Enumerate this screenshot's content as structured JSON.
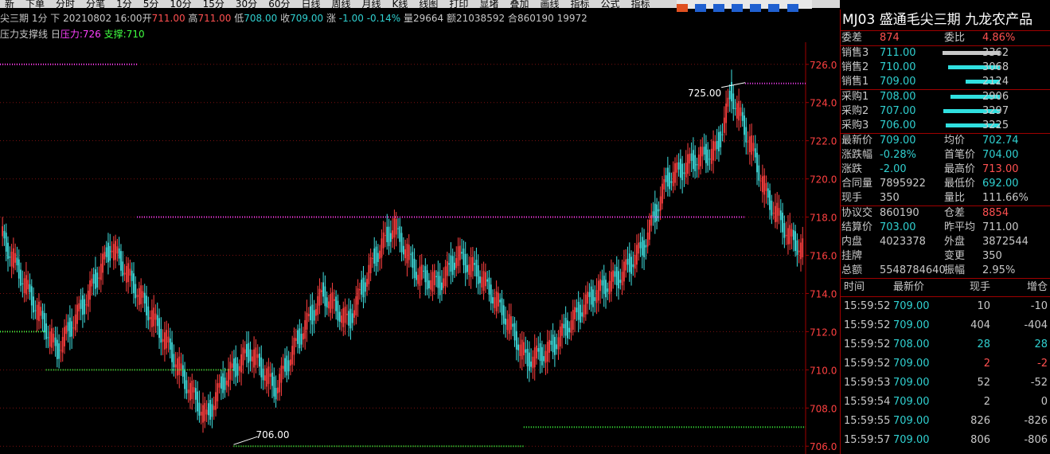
{
  "menubar": [
    "新",
    "下单",
    "分时",
    "分笔",
    "1分",
    "5分",
    "10分",
    "15分",
    "30分",
    "60分",
    "日线",
    "周线",
    "月线",
    "K线",
    "线图",
    "打印",
    "显堵",
    "叠加",
    "画线",
    "指标",
    "公式",
    "指标"
  ],
  "info": {
    "name": "尖三期 1分 下",
    "date": "20210802 16:00",
    "open_label": "开",
    "open": "711.00",
    "high_label": "高",
    "high": "711.00",
    "low_label": "低",
    "low": "708.00",
    "close_label": "收",
    "close": "709.00",
    "chg_label": "涨",
    "chg": "-1.00",
    "chg_pct": "-0.14%",
    "vol_label": "量",
    "vol": "29664",
    "amt_label": "额",
    "amt": "21038592",
    "oi_label": "合",
    "oi": "860190",
    "extra": "19972"
  },
  "legend": {
    "name": "压力支撑线",
    "collapse": "日",
    "resistance_label": "压力:",
    "resistance": "726",
    "support_label": "支撑:",
    "support": "710"
  },
  "chart_data": {
    "type": "candlestick",
    "ylim": [
      706,
      727
    ],
    "yticks": [
      "726.0",
      "724.0",
      "722.0",
      "720.0",
      "718.0",
      "716.0",
      "714.0",
      "712.0",
      "710.0",
      "708.0",
      "706.0"
    ],
    "annotations": [
      {
        "text": "725.00",
        "value": 725
      },
      {
        "text": "706.00",
        "value": 706
      }
    ],
    "resistance_lines": [
      726,
      718,
      725
    ],
    "support_lines": [
      712,
      710,
      706,
      707
    ],
    "colors": {
      "up": "#ff4040",
      "down": "#40e0e0",
      "resistance": "#ff40ff",
      "support": "#40ff40",
      "grid": "#7a1010",
      "axis": "#a00000"
    }
  },
  "panel": {
    "title": "MJ03  盛通毛尖三期   九龙农产品",
    "weicha_label": "委差",
    "weicha": "874",
    "weibi_label": "委比",
    "weibi": "4.86%",
    "asks": [
      {
        "label": "销售3",
        "price": "711.00",
        "vol": "3362",
        "bar": 1.0,
        "grey": true
      },
      {
        "label": "销售2",
        "price": "710.00",
        "vol": "3068",
        "bar": 0.9
      },
      {
        "label": "销售1",
        "price": "709.00",
        "vol": "2124",
        "bar": 0.6
      }
    ],
    "bids": [
      {
        "label": "采购1",
        "price": "708.00",
        "vol": "2906",
        "bar": 0.86
      },
      {
        "label": "采购2",
        "price": "707.00",
        "vol": "3297",
        "bar": 0.98
      },
      {
        "label": "采购3",
        "price": "706.00",
        "vol": "3225",
        "bar": 0.95
      }
    ],
    "stats1": [
      {
        "l1": "最新价",
        "v1": "709.00",
        "c1": "g",
        "l2": "均价",
        "v2": "702.74",
        "c2": "g"
      },
      {
        "l1": "涨跌幅",
        "v1": "-0.28%",
        "c1": "g",
        "l2": "首笔价",
        "v2": "704.00",
        "c2": "g"
      },
      {
        "l1": "涨跌",
        "v1": "-2.00",
        "c1": "g",
        "l2": "最高价",
        "v2": "713.00",
        "c2": "r"
      },
      {
        "l1": "合同量",
        "v1": "7895922",
        "c1": "w",
        "l2": "最低价",
        "v2": "692.00",
        "c2": "g"
      },
      {
        "l1": "现手",
        "v1": "350",
        "c1": "w",
        "l2": "量比",
        "v2": "111.66%",
        "c2": "w"
      }
    ],
    "stats2": [
      {
        "l1": "协议交",
        "v1": "860190",
        "c1": "w",
        "l2": "仓差",
        "v2": "8854",
        "c2": "r"
      },
      {
        "l1": "结算价",
        "v1": "703.00",
        "c1": "g",
        "l2": "昨平均",
        "v2": "711.00",
        "c2": "w"
      },
      {
        "l1": "内盘",
        "v1": "4023378",
        "c1": "w",
        "l2": "外盘",
        "v2": "3872544",
        "c2": "w"
      },
      {
        "l1": "挂牌",
        "v1": "",
        "c1": "w",
        "l2": "变更",
        "v2": "350",
        "c2": "w"
      },
      {
        "l1": "总额",
        "v1": "5548784640",
        "c1": "w",
        "l2": "振幅",
        "v2": "2.95%",
        "c2": "w"
      }
    ],
    "ticks_header": {
      "time": "时间",
      "price": "最新价",
      "vol": "现手",
      "oi": "增仓"
    },
    "ticks": [
      {
        "time": "15:59:52",
        "price": "709.00",
        "pc": "g",
        "vol": "10",
        "vc": "w",
        "oi": "-10",
        "oc": "w"
      },
      {
        "time": "15:59:52",
        "price": "709.00",
        "pc": "g",
        "vol": "404",
        "vc": "w",
        "oi": "-404",
        "oc": "w"
      },
      {
        "time": "15:59:52",
        "price": "708.00",
        "pc": "g",
        "vol": "28",
        "vc": "g",
        "oi": "28",
        "oc": "g"
      },
      {
        "time": "15:59:52",
        "price": "709.00",
        "pc": "g",
        "vol": "2",
        "vc": "r",
        "oi": "-2",
        "oc": "r"
      },
      {
        "time": "15:59:53",
        "price": "709.00",
        "pc": "g",
        "vol": "52",
        "vc": "w",
        "oi": "-52",
        "oc": "w"
      },
      {
        "time": "15:59:54",
        "price": "709.00",
        "pc": "g",
        "vol": "2",
        "vc": "w",
        "oi": "0",
        "oc": "w"
      },
      {
        "time": "15:59:55",
        "price": "709.00",
        "pc": "g",
        "vol": "826",
        "vc": "w",
        "oi": "-826",
        "oc": "w"
      },
      {
        "time": "15:59:57",
        "price": "709.00",
        "pc": "g",
        "vol": "806",
        "vc": "w",
        "oi": "-806",
        "oc": "w"
      }
    ]
  }
}
